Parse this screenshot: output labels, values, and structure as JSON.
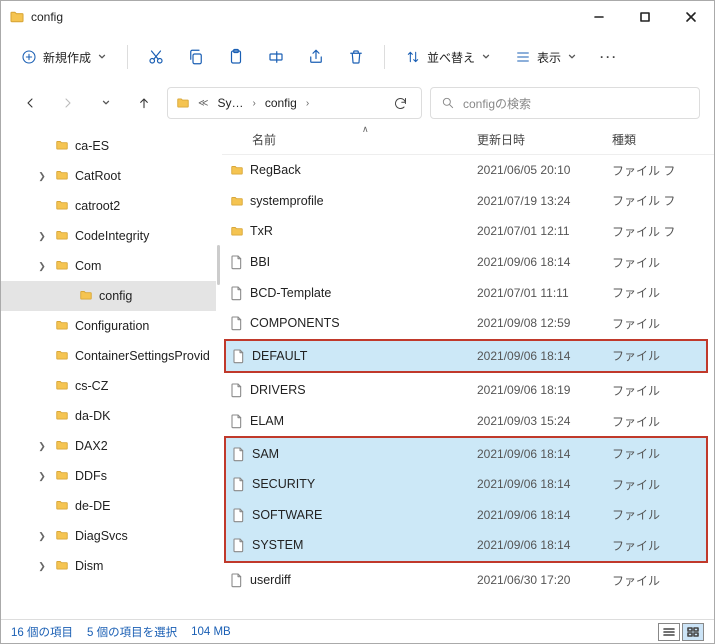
{
  "window": {
    "title": "config"
  },
  "toolbar": {
    "new_label": "新規作成",
    "sort_label": "並べ替え",
    "view_label": "表示"
  },
  "address": {
    "crumb1": "Sy…",
    "crumb2": "config"
  },
  "search": {
    "placeholder": "configの検索"
  },
  "columns": {
    "name": "名前",
    "date": "更新日時",
    "type": "種類"
  },
  "tree": [
    {
      "label": "ca-ES",
      "depth": 1,
      "expander": false
    },
    {
      "label": "CatRoot",
      "depth": 1,
      "expander": true
    },
    {
      "label": "catroot2",
      "depth": 1,
      "expander": false
    },
    {
      "label": "CodeIntegrity",
      "depth": 1,
      "expander": true
    },
    {
      "label": "Com",
      "depth": 1,
      "expander": true
    },
    {
      "label": "config",
      "depth": 2,
      "expander": false,
      "selected": true
    },
    {
      "label": "Configuration",
      "depth": 1,
      "expander": false
    },
    {
      "label": "ContainerSettingsProvid",
      "depth": 1,
      "expander": false
    },
    {
      "label": "cs-CZ",
      "depth": 1,
      "expander": false
    },
    {
      "label": "da-DK",
      "depth": 1,
      "expander": false
    },
    {
      "label": "DAX2",
      "depth": 1,
      "expander": true
    },
    {
      "label": "DDFs",
      "depth": 1,
      "expander": true
    },
    {
      "label": "de-DE",
      "depth": 1,
      "expander": false
    },
    {
      "label": "DiagSvcs",
      "depth": 1,
      "expander": true
    },
    {
      "label": "Dism",
      "depth": 1,
      "expander": true
    }
  ],
  "files": [
    {
      "name": "RegBack",
      "date": "2021/06/05 20:10",
      "type": "ファイル フ",
      "icon": "folder"
    },
    {
      "name": "systemprofile",
      "date": "2021/07/19 13:24",
      "type": "ファイル フ",
      "icon": "folder"
    },
    {
      "name": "TxR",
      "date": "2021/07/01 12:11",
      "type": "ファイル フ",
      "icon": "folder"
    },
    {
      "name": "BBI",
      "date": "2021/09/06 18:14",
      "type": "ファイル",
      "icon": "file"
    },
    {
      "name": "BCD-Template",
      "date": "2021/07/01 11:11",
      "type": "ファイル",
      "icon": "file"
    },
    {
      "name": "COMPONENTS",
      "date": "2021/09/08 12:59",
      "type": "ファイル",
      "icon": "file"
    },
    {
      "name": "DEFAULT",
      "date": "2021/09/06 18:14",
      "type": "ファイル",
      "icon": "file",
      "selected": true,
      "group": 1
    },
    {
      "name": "DRIVERS",
      "date": "2021/09/06 18:19",
      "type": "ファイル",
      "icon": "file"
    },
    {
      "name": "ELAM",
      "date": "2021/09/03 15:24",
      "type": "ファイル",
      "icon": "file"
    },
    {
      "name": "SAM",
      "date": "2021/09/06 18:14",
      "type": "ファイル",
      "icon": "file",
      "selected": true,
      "group": 2
    },
    {
      "name": "SECURITY",
      "date": "2021/09/06 18:14",
      "type": "ファイル",
      "icon": "file",
      "selected": true,
      "group": 2
    },
    {
      "name": "SOFTWARE",
      "date": "2021/09/06 18:14",
      "type": "ファイル",
      "icon": "file",
      "selected": true,
      "group": 2
    },
    {
      "name": "SYSTEM",
      "date": "2021/09/06 18:14",
      "type": "ファイル",
      "icon": "file",
      "selected": true,
      "group": 2
    },
    {
      "name": "userdiff",
      "date": "2021/06/30 17:20",
      "type": "ファイル",
      "icon": "file"
    }
  ],
  "status": {
    "count": "16 個の項目",
    "selected": "5 個の項目を選択",
    "size": "104 MB"
  }
}
